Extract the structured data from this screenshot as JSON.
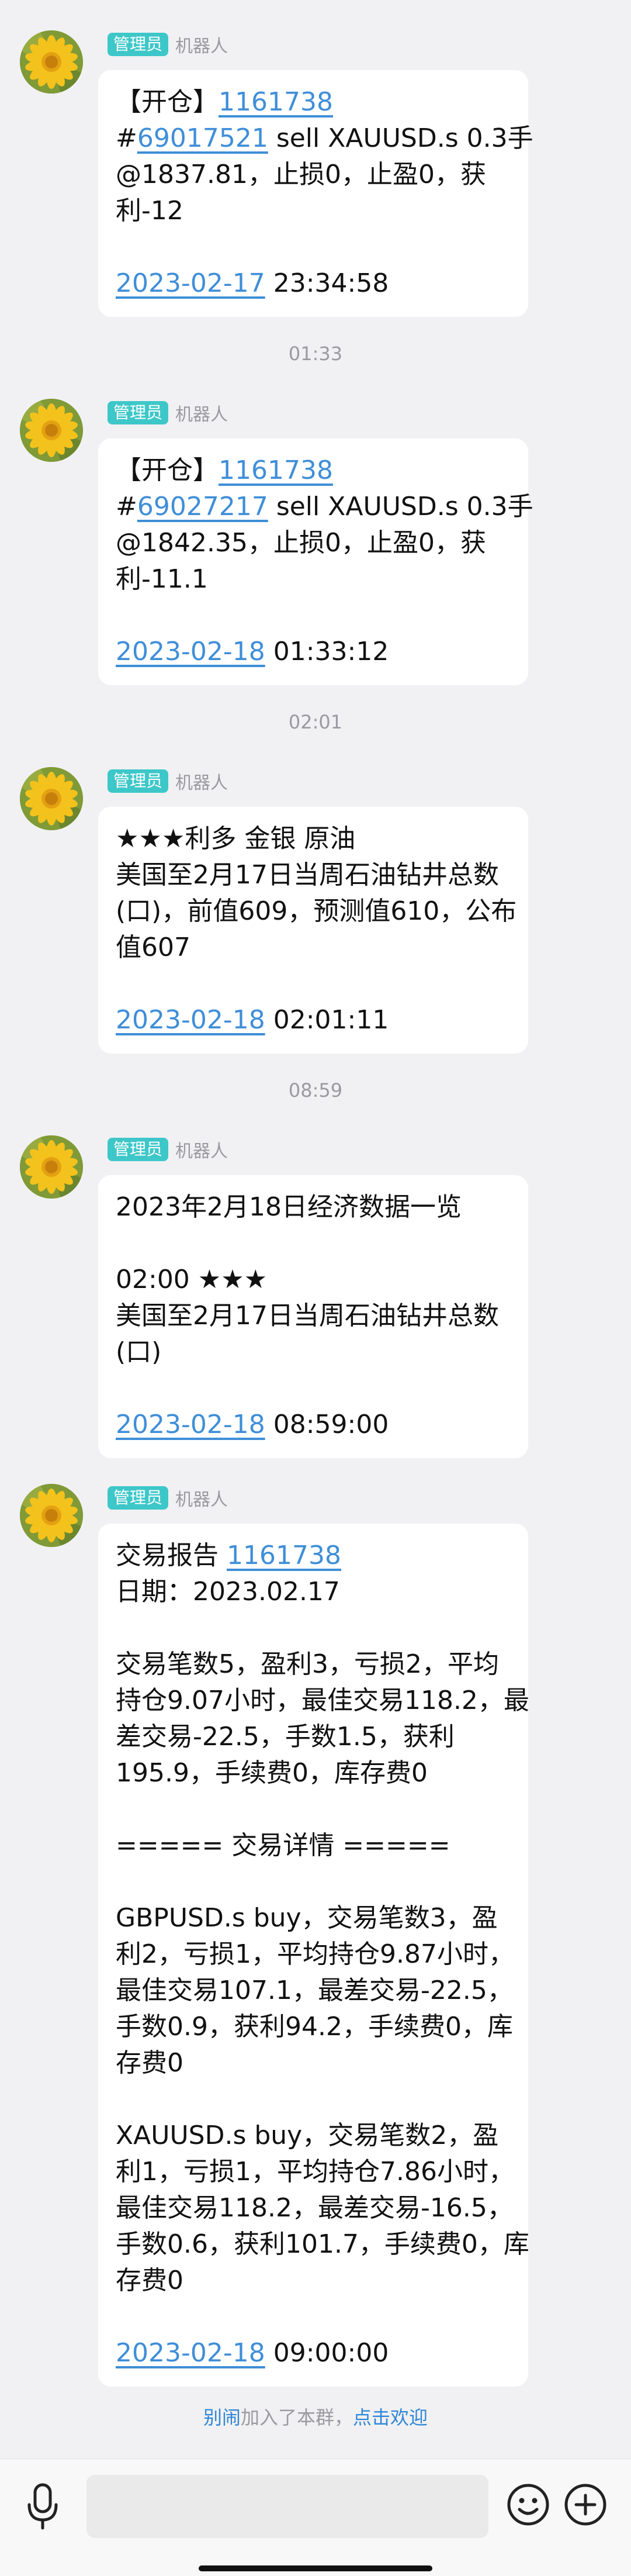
{
  "messages": [
    {
      "badge": "管理员",
      "sender": "机器人",
      "lines": [
        [
          {
            "t": "【开仓】"
          },
          {
            "t": "1161738",
            "link": true
          }
        ],
        [
          {
            "t": "#"
          },
          {
            "t": "69017521",
            "link": true
          },
          {
            "t": " sell XAUUSD.s 0.3手"
          }
        ],
        [
          {
            "t": "@1837.81，止损0，止盈0，获"
          }
        ],
        [
          {
            "t": "利-12"
          }
        ],
        [],
        [
          {
            "t": "2023-02-17",
            "link": true
          },
          {
            "t": " 23:34:58"
          }
        ]
      ]
    },
    {
      "badge": "管理员",
      "sender": "机器人",
      "lines": [
        [
          {
            "t": "【开仓】"
          },
          {
            "t": "1161738",
            "link": true
          }
        ],
        [
          {
            "t": "#"
          },
          {
            "t": "69027217",
            "link": true
          },
          {
            "t": " sell XAUUSD.s 0.3手"
          }
        ],
        [
          {
            "t": "@1842.35，止损0，止盈0，获"
          }
        ],
        [
          {
            "t": "利-11.1"
          }
        ],
        [],
        [
          {
            "t": "2023-02-18",
            "link": true
          },
          {
            "t": " 01:33:12"
          }
        ]
      ]
    },
    {
      "badge": "管理员",
      "sender": "机器人",
      "lines": [
        [
          {
            "t": "★★★利多 金银 原油"
          }
        ],
        [
          {
            "t": "美国至2月17日当周石油钻井总数"
          }
        ],
        [
          {
            "t": "(口)，前值609，预测值610，公布"
          }
        ],
        [
          {
            "t": "值607"
          }
        ],
        [],
        [
          {
            "t": "2023-02-18",
            "link": true
          },
          {
            "t": " 02:01:11"
          }
        ]
      ]
    },
    {
      "badge": "管理员",
      "sender": "机器人",
      "lines": [
        [
          {
            "t": "2023年2月18日经济数据一览"
          }
        ],
        [],
        [
          {
            "t": "02:00 ★★★"
          }
        ],
        [
          {
            "t": "美国至2月17日当周石油钻井总数"
          }
        ],
        [
          {
            "t": "(口)"
          }
        ],
        [],
        [
          {
            "t": "2023-02-18",
            "link": true
          },
          {
            "t": " 08:59:00"
          }
        ]
      ]
    },
    {
      "badge": "管理员",
      "sender": "机器人",
      "lines": [
        [
          {
            "t": "交易报告 "
          },
          {
            "t": "1161738",
            "link": true
          }
        ],
        [
          {
            "t": "日期：2023.02.17"
          }
        ],
        [],
        [
          {
            "t": "交易笔数5，盈利3，亏损2，平均"
          }
        ],
        [
          {
            "t": "持仓9.07小时，最佳交易118.2，最"
          }
        ],
        [
          {
            "t": "差交易-22.5，手数1.5，获利"
          }
        ],
        [
          {
            "t": "195.9，手续费0，库存费0"
          }
        ],
        [],
        [
          {
            "t": "===== 交易详情 ====="
          }
        ],
        [],
        [
          {
            "t": "GBPUSD.s buy，交易笔数3，盈"
          }
        ],
        [
          {
            "t": "利2，亏损1，平均持仓9.87小时，"
          }
        ],
        [
          {
            "t": "最佳交易107.1，最差交易-22.5，"
          }
        ],
        [
          {
            "t": "手数0.9，获利94.2，手续费0，库"
          }
        ],
        [
          {
            "t": "存费0"
          }
        ],
        [],
        [
          {
            "t": "XAUUSD.s buy，交易笔数2，盈"
          }
        ],
        [
          {
            "t": "利1，亏损1，平均持仓7.86小时，"
          }
        ],
        [
          {
            "t": "最佳交易118.2，最差交易-16.5，"
          }
        ],
        [
          {
            "t": "手数0.6，获利101.7，手续费0，库"
          }
        ],
        [
          {
            "t": "存费0"
          }
        ],
        [],
        [
          {
            "t": "2023-02-18",
            "link": true
          },
          {
            "t": " 09:00:00"
          }
        ]
      ]
    }
  ],
  "separators": [
    "01:33",
    "02:01",
    "08:59"
  ],
  "notice": {
    "name": "别闹",
    "text": "加入了本群，",
    "action": "点击欢迎"
  },
  "composer": {
    "mic_icon": "microphone-icon",
    "emoji_icon": "emoji-icon",
    "plus_icon": "plus-icon"
  }
}
